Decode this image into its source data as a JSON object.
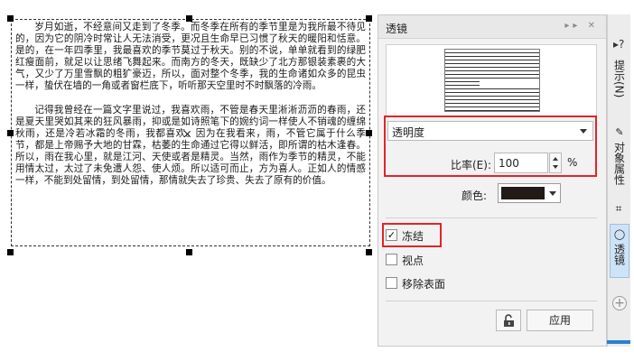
{
  "document": {
    "paragraph1": "岁月如逝，不经意间又走到了冬季。而冬季在所有的季节里是为我所最不待见的，因为它的阴冷时常让人无法消受，更况且生命早已习惯了秋天的暖阳和恬意。是的，在一年四季里，我最喜欢的季节莫过于秋天。别的不说，单单就看到的绿肥红瘦面前，就足以让思绪飞舞起来。而南方的冬天，既缺少了北方那银装素裹的大气，又少了万里雪飘的粗犷豪迈，所以，面对整个冬季，我的生命诸如众多的昆虫一样，蛰伏在墙的一角或者窗栏底下，听听那天空里时不时飘落的冷雨。",
    "paragraph2": "记得我曾经在一篇文字里说过，我喜欢雨，不管是春天里淅淅沥沥的春雨，还是夏天里哭如其来的狂风暴雨，抑或是如诗照笔下的婉约词一样使人不销魂的缠绵秋雨，还是冷若冰霜的冬雨，我都喜欢。因为在我看来，雨，不管它属于什么季节，都是上帝赐予大地的甘霖，枯萎的生命通过它得以鲜活，即所谓的枯木逢春。所以，雨在我心里，就是江河、天使或者是精灵。当然，雨作为季节的精灵，不能用情太过，太过了未免遭人怨、使人烦。所以适可而止，方为喜人。正如人的情感一样，不能到处留情，到处留情，那情就失去了珍贵、失去了原有的价值。"
  },
  "docker": {
    "title": "透镜",
    "header_buttons": "▸▸ ✕",
    "lens_type": "透明度",
    "rate_label": "比率(E):",
    "rate_value": "100",
    "percent_sign": "%",
    "color_label": "颜色:",
    "color_value": "#221a17",
    "freeze_label": "冻结",
    "freeze_checked": "✓",
    "viewpoint_label": "视点",
    "remove_face_label": "移除表面",
    "apply_label": "应用"
  },
  "tabs": [
    {
      "label": "提示(N)",
      "icon": "?"
    },
    {
      "label": "对象属性",
      "icon": "✎"
    },
    {
      "label": "⌗",
      "icon": ""
    },
    {
      "label": "透镜",
      "icon": "◯"
    }
  ],
  "colors": {
    "highlight_red": "#e0242b",
    "active_tab": "#cfe3f6",
    "accent_blue": "#2a7fd4"
  }
}
